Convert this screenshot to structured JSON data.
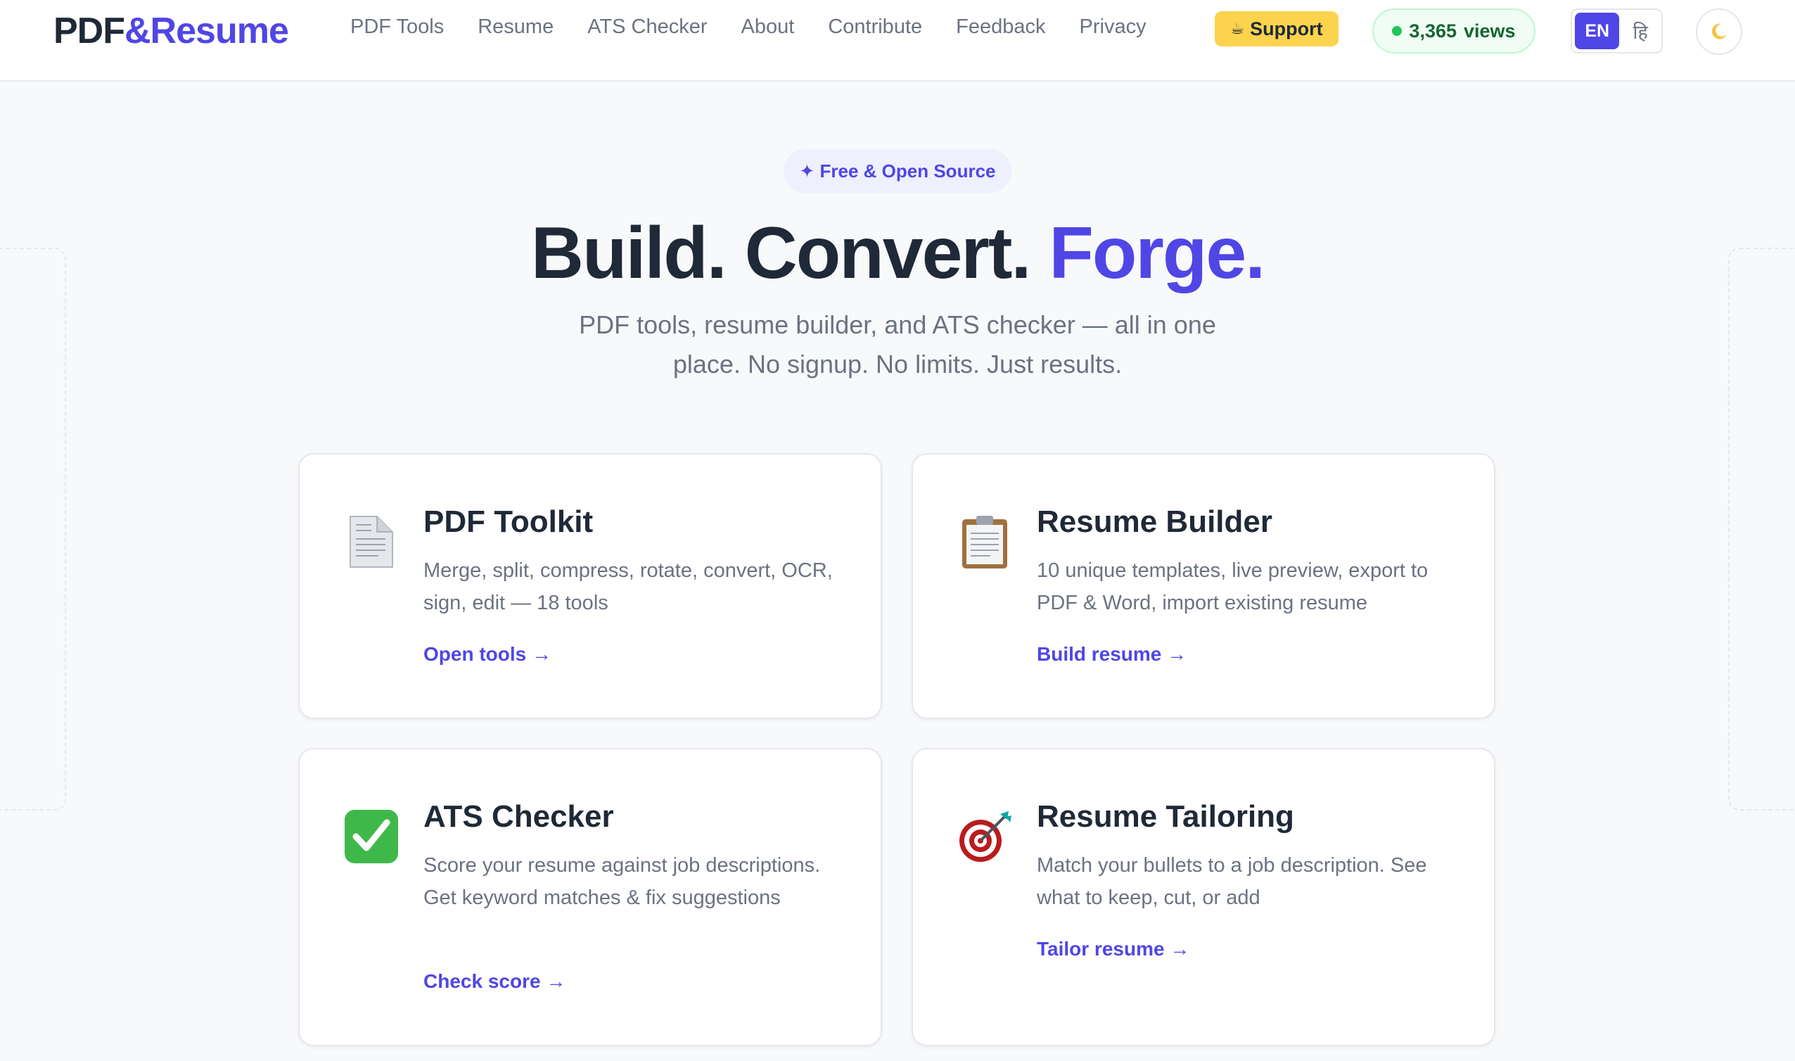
{
  "header": {
    "logo_part1": "PDF",
    "logo_part2": "&Resume",
    "nav": [
      "PDF Tools",
      "Resume",
      "ATS Checker",
      "About",
      "Contribute",
      "Feedback",
      "Privacy"
    ],
    "support_label": "Support",
    "views_count": "3,365",
    "views_label": "views",
    "lang_en": "EN",
    "lang_hi": "हि"
  },
  "hero": {
    "badge": "✦ Free & Open Source",
    "headline_part1": "Build. Convert. ",
    "headline_part2": "Forge",
    "headline_part3": ".",
    "subtitle": "PDF tools, resume builder, and ATS checker — all in one place. No signup. No limits. Just results."
  },
  "cards": [
    {
      "icon": "document-icon",
      "title": "PDF Toolkit",
      "desc": "Merge, split, compress, rotate, convert, OCR, sign, edit — 18 tools",
      "link": "Open tools →"
    },
    {
      "icon": "clipboard-icon",
      "title": "Resume Builder",
      "desc": "10 unique templates, live preview, export to PDF & Word, import existing resume",
      "link": "Build resume →"
    },
    {
      "icon": "checkmark-icon",
      "title": "ATS Checker",
      "desc": "Score your resume against job descriptions. Get keyword matches & fix suggestions",
      "link": "Check score →"
    },
    {
      "icon": "target-icon",
      "title": "Resume Tailoring",
      "desc": "Match your bullets to a job description. See what to keep, cut, or add",
      "link": "Tailor resume →"
    }
  ],
  "colors": {
    "accent": "#4f46e5",
    "support_bg": "#fcd34d",
    "views_green": "#22c55e",
    "checkmark_green": "#3fb84a",
    "target_red": "#b91c1c"
  }
}
